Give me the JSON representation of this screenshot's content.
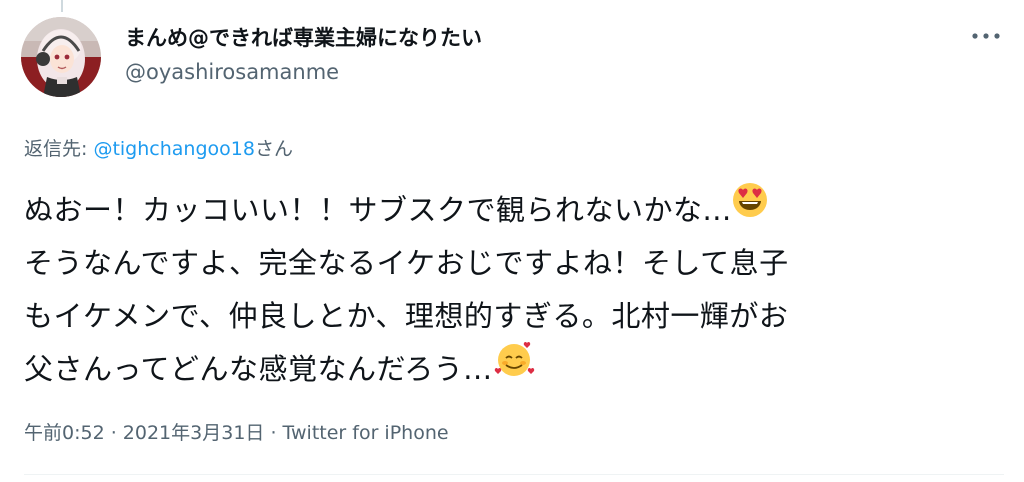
{
  "author": {
    "display_name": "まんめ@できれば専業主婦になりたい",
    "username": "@oyashirosamanme"
  },
  "reply": {
    "prefix": "返信先: ",
    "mention": "@tighchangoo18",
    "suffix": "さん"
  },
  "tweet": {
    "line1": "ぬおー！カッコいい！！サブスクで観られないかな...",
    "line2": "そうなんですよ、完全なるイケおじですよね！そして息子",
    "line3": "もイケメンで、仲良しとか、理想的すぎる。北村一輝がお",
    "line4": "父さんってどんな感覚なんだろう...",
    "emojis": [
      "heart-eyes-emoji",
      "smiling-face-with-hearts-emoji"
    ]
  },
  "meta": {
    "time": "午前0:52",
    "separator1": " · ",
    "date": "2021年3月31日",
    "separator2": " · ",
    "source": "Twitter for iPhone"
  },
  "colors": {
    "link": "#1d9bf0",
    "secondary_text": "#536471",
    "primary_text": "#0f1419"
  }
}
